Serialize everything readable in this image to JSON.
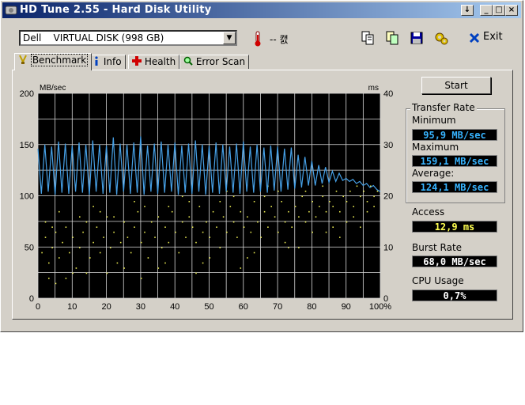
{
  "window": {
    "title": "HD Tune 2.55 - Hard Disk Utility"
  },
  "titlebar_buttons": {
    "down": "↓",
    "min": "_",
    "max": "□",
    "close": "×"
  },
  "drive": {
    "selected": "Dell    VIRTUAL DISK (998 GB)"
  },
  "temperature": {
    "value": "-- 캜"
  },
  "toolbar": {
    "exit_label": "Exit"
  },
  "tabs": [
    {
      "label": "Benchmark",
      "icon": "benchmark-icon"
    },
    {
      "label": "Info",
      "icon": "info-icon"
    },
    {
      "label": "Health",
      "icon": "health-cross-icon"
    },
    {
      "label": "Error Scan",
      "icon": "magnifier-icon"
    }
  ],
  "buttons": {
    "start": "Start"
  },
  "transfer_rate": {
    "title": "Transfer Rate",
    "min_label": "Minimum",
    "min_value": "95,9 MB/sec",
    "max_label": "Maximum",
    "max_value": "159,1 MB/sec",
    "avg_label": "Average:",
    "avg_value": "124,1 MB/sec"
  },
  "access": {
    "label": "Access",
    "value": "12,9 ms"
  },
  "burst": {
    "label": "Burst Rate",
    "value": "68,0 MB/sec"
  },
  "cpu": {
    "label": "CPU Usage",
    "value": "0,7%"
  },
  "colors": {
    "transfer_line": "#46a0e6",
    "access_dots": "#e6e650",
    "value_blue": "#37b4ff",
    "value_yellow": "#ffff50",
    "value_white": "#ffffff"
  },
  "chart_data": {
    "type": "line",
    "ylabel": "MB/sec",
    "y2label": "ms",
    "x_ticks": [
      "0",
      "10",
      "20",
      "30",
      "40",
      "50",
      "60",
      "70",
      "80",
      "90",
      "100%"
    ],
    "y_ticks": [
      "0",
      "50",
      "100",
      "150",
      "200"
    ],
    "y2_ticks": [
      "0",
      "10",
      "20",
      "30",
      "40"
    ],
    "xlim": [
      0,
      100
    ],
    "ylim": [
      0,
      200
    ],
    "y2lim": [
      0,
      40
    ],
    "grid": true,
    "series": [
      {
        "kind": "transfer",
        "x": [
          0,
          1,
          2,
          3,
          4,
          5,
          6,
          7,
          8,
          9,
          10,
          11,
          12,
          13,
          14,
          15,
          16,
          17,
          18,
          19,
          20,
          21,
          22,
          23,
          24,
          25,
          26,
          27,
          28,
          29,
          30,
          31,
          32,
          33,
          34,
          35,
          36,
          37,
          38,
          39,
          40,
          41,
          42,
          43,
          44,
          45,
          46,
          47,
          48,
          49,
          50,
          51,
          52,
          53,
          54,
          55,
          56,
          57,
          58,
          59,
          60,
          61,
          62,
          63,
          64,
          65,
          66,
          67,
          68,
          69,
          70,
          71,
          72,
          73,
          74,
          75,
          76,
          77,
          78,
          79,
          80,
          81,
          82,
          83,
          84,
          85,
          86,
          87,
          88,
          89,
          90,
          91,
          92,
          93,
          94,
          95,
          96,
          97,
          98,
          99,
          100
        ],
        "values": [
          146,
          102,
          150,
          104,
          148,
          101,
          153,
          103,
          151,
          102,
          149,
          104,
          152,
          103,
          150,
          101,
          154,
          104,
          150,
          102,
          149,
          103,
          157,
          101,
          151,
          104,
          150,
          102,
          152,
          103,
          158,
          101,
          149,
          104,
          151,
          102,
          153,
          103,
          150,
          104,
          152,
          101,
          149,
          103,
          151,
          102,
          154,
          104,
          150,
          101,
          149,
          103,
          152,
          102,
          150,
          104,
          148,
          103,
          151,
          102,
          153,
          104,
          148,
          103,
          150,
          104,
          147,
          103,
          149,
          105,
          148,
          104,
          146,
          106,
          147,
          107,
          140,
          108,
          138,
          110,
          134,
          110,
          130,
          112,
          128,
          113,
          124,
          114,
          122,
          115,
          117,
          114,
          116,
          112,
          114,
          110,
          112,
          108,
          110,
          106,
          104
        ]
      },
      {
        "kind": "access",
        "points": [
          [
            1,
            9
          ],
          [
            2,
            12
          ],
          [
            3,
            7
          ],
          [
            4,
            10
          ],
          [
            5,
            13
          ],
          [
            6,
            8
          ],
          [
            7,
            11
          ],
          [
            8,
            14
          ],
          [
            9,
            9
          ],
          [
            10,
            12
          ],
          [
            11,
            6
          ],
          [
            12,
            10
          ],
          [
            13,
            13
          ],
          [
            14,
            15
          ],
          [
            15,
            8
          ],
          [
            16,
            11
          ],
          [
            17,
            14
          ],
          [
            18,
            9
          ],
          [
            19,
            12
          ],
          [
            20,
            16
          ],
          [
            21,
            10
          ],
          [
            22,
            13
          ],
          [
            23,
            7
          ],
          [
            24,
            11
          ],
          [
            25,
            15
          ],
          [
            26,
            12
          ],
          [
            27,
            9
          ],
          [
            28,
            14
          ],
          [
            29,
            17
          ],
          [
            30,
            11
          ],
          [
            31,
            13
          ],
          [
            32,
            8
          ],
          [
            33,
            15
          ],
          [
            34,
            12
          ],
          [
            35,
            16
          ],
          [
            36,
            10
          ],
          [
            37,
            14
          ],
          [
            38,
            11
          ],
          [
            39,
            17
          ],
          [
            40,
            13
          ],
          [
            41,
            9
          ],
          [
            42,
            15
          ],
          [
            43,
            12
          ],
          [
            44,
            16
          ],
          [
            45,
            14
          ],
          [
            46,
            11
          ],
          [
            47,
            18
          ],
          [
            48,
            13
          ],
          [
            49,
            15
          ],
          [
            50,
            12
          ],
          [
            51,
            17
          ],
          [
            52,
            14
          ],
          [
            53,
            10
          ],
          [
            54,
            16
          ],
          [
            55,
            13
          ],
          [
            56,
            18
          ],
          [
            57,
            15
          ],
          [
            58,
            12
          ],
          [
            59,
            17
          ],
          [
            60,
            14
          ],
          [
            61,
            16
          ],
          [
            62,
            13
          ],
          [
            63,
            19
          ],
          [
            64,
            15
          ],
          [
            65,
            12
          ],
          [
            66,
            17
          ],
          [
            67,
            14
          ],
          [
            68,
            18
          ],
          [
            69,
            16
          ],
          [
            70,
            13
          ],
          [
            71,
            19
          ],
          [
            72,
            15
          ],
          [
            73,
            17
          ],
          [
            74,
            14
          ],
          [
            75,
            18
          ],
          [
            76,
            16
          ],
          [
            77,
            20
          ],
          [
            78,
            15
          ],
          [
            79,
            17
          ],
          [
            80,
            19
          ],
          [
            81,
            16
          ],
          [
            82,
            18
          ],
          [
            83,
            20
          ],
          [
            84,
            17
          ],
          [
            85,
            19
          ],
          [
            86,
            18
          ],
          [
            87,
            21
          ],
          [
            88,
            17
          ],
          [
            89,
            20
          ],
          [
            90,
            19
          ],
          [
            91,
            21
          ],
          [
            92,
            18
          ],
          [
            93,
            22
          ],
          [
            94,
            20
          ],
          [
            95,
            21
          ],
          [
            96,
            19
          ],
          [
            97,
            22
          ],
          [
            98,
            20
          ],
          [
            99,
            21
          ],
          [
            3,
            4
          ],
          [
            5,
            3
          ],
          [
            2,
            15
          ],
          [
            8,
            4
          ],
          [
            14,
            5
          ],
          [
            18,
            17
          ],
          [
            25,
            6
          ],
          [
            31,
            18
          ],
          [
            37,
            7
          ],
          [
            44,
            19
          ],
          [
            50,
            8
          ],
          [
            57,
            20
          ],
          [
            63,
            9
          ],
          [
            70,
            21
          ],
          [
            76,
            10
          ],
          [
            83,
            22
          ],
          [
            88,
            12
          ],
          [
            94,
            14
          ],
          [
            6,
            17
          ],
          [
            12,
            16
          ],
          [
            20,
            5
          ],
          [
            28,
            19
          ],
          [
            35,
            6
          ],
          [
            42,
            20
          ],
          [
            48,
            7
          ],
          [
            55,
            21
          ],
          [
            61,
            8
          ],
          [
            67,
            22
          ],
          [
            73,
            10
          ],
          [
            80,
            13
          ],
          [
            86,
            14
          ],
          [
            92,
            16
          ],
          [
            98,
            18
          ],
          [
            4,
            14
          ],
          [
            10,
            5
          ],
          [
            16,
            18
          ],
          [
            22,
            16
          ],
          [
            30,
            4
          ],
          [
            38,
            18
          ],
          [
            46,
            5
          ],
          [
            53,
            19
          ],
          [
            59,
            6
          ],
          [
            66,
            20
          ],
          [
            72,
            11
          ],
          [
            78,
            21
          ],
          [
            84,
            13
          ],
          [
            90,
            15
          ],
          [
            96,
            17
          ]
        ]
      }
    ]
  }
}
